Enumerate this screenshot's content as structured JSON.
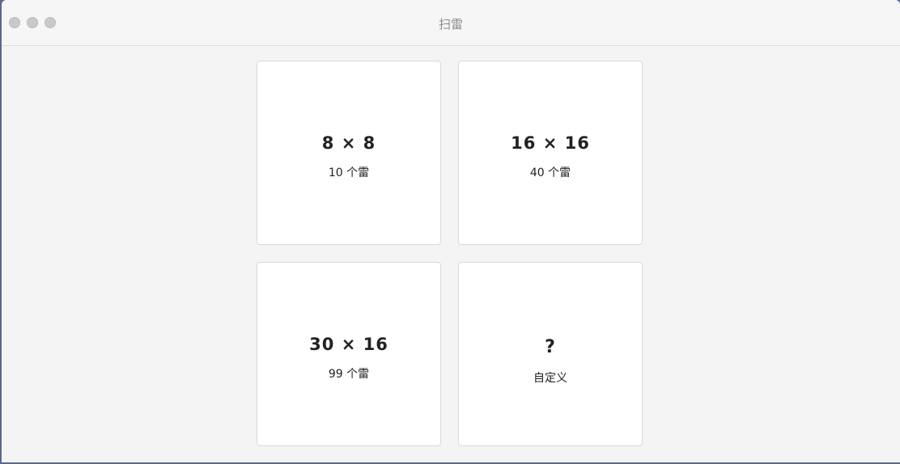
{
  "window": {
    "title": "扫雷"
  },
  "options": [
    {
      "size": "8 × 8",
      "mines": "10 个雷"
    },
    {
      "size": "16 × 16",
      "mines": "40 个雷"
    },
    {
      "size": "30 × 16",
      "mines": "99 个雷"
    },
    {
      "size": "?",
      "mines": "自定义"
    }
  ]
}
